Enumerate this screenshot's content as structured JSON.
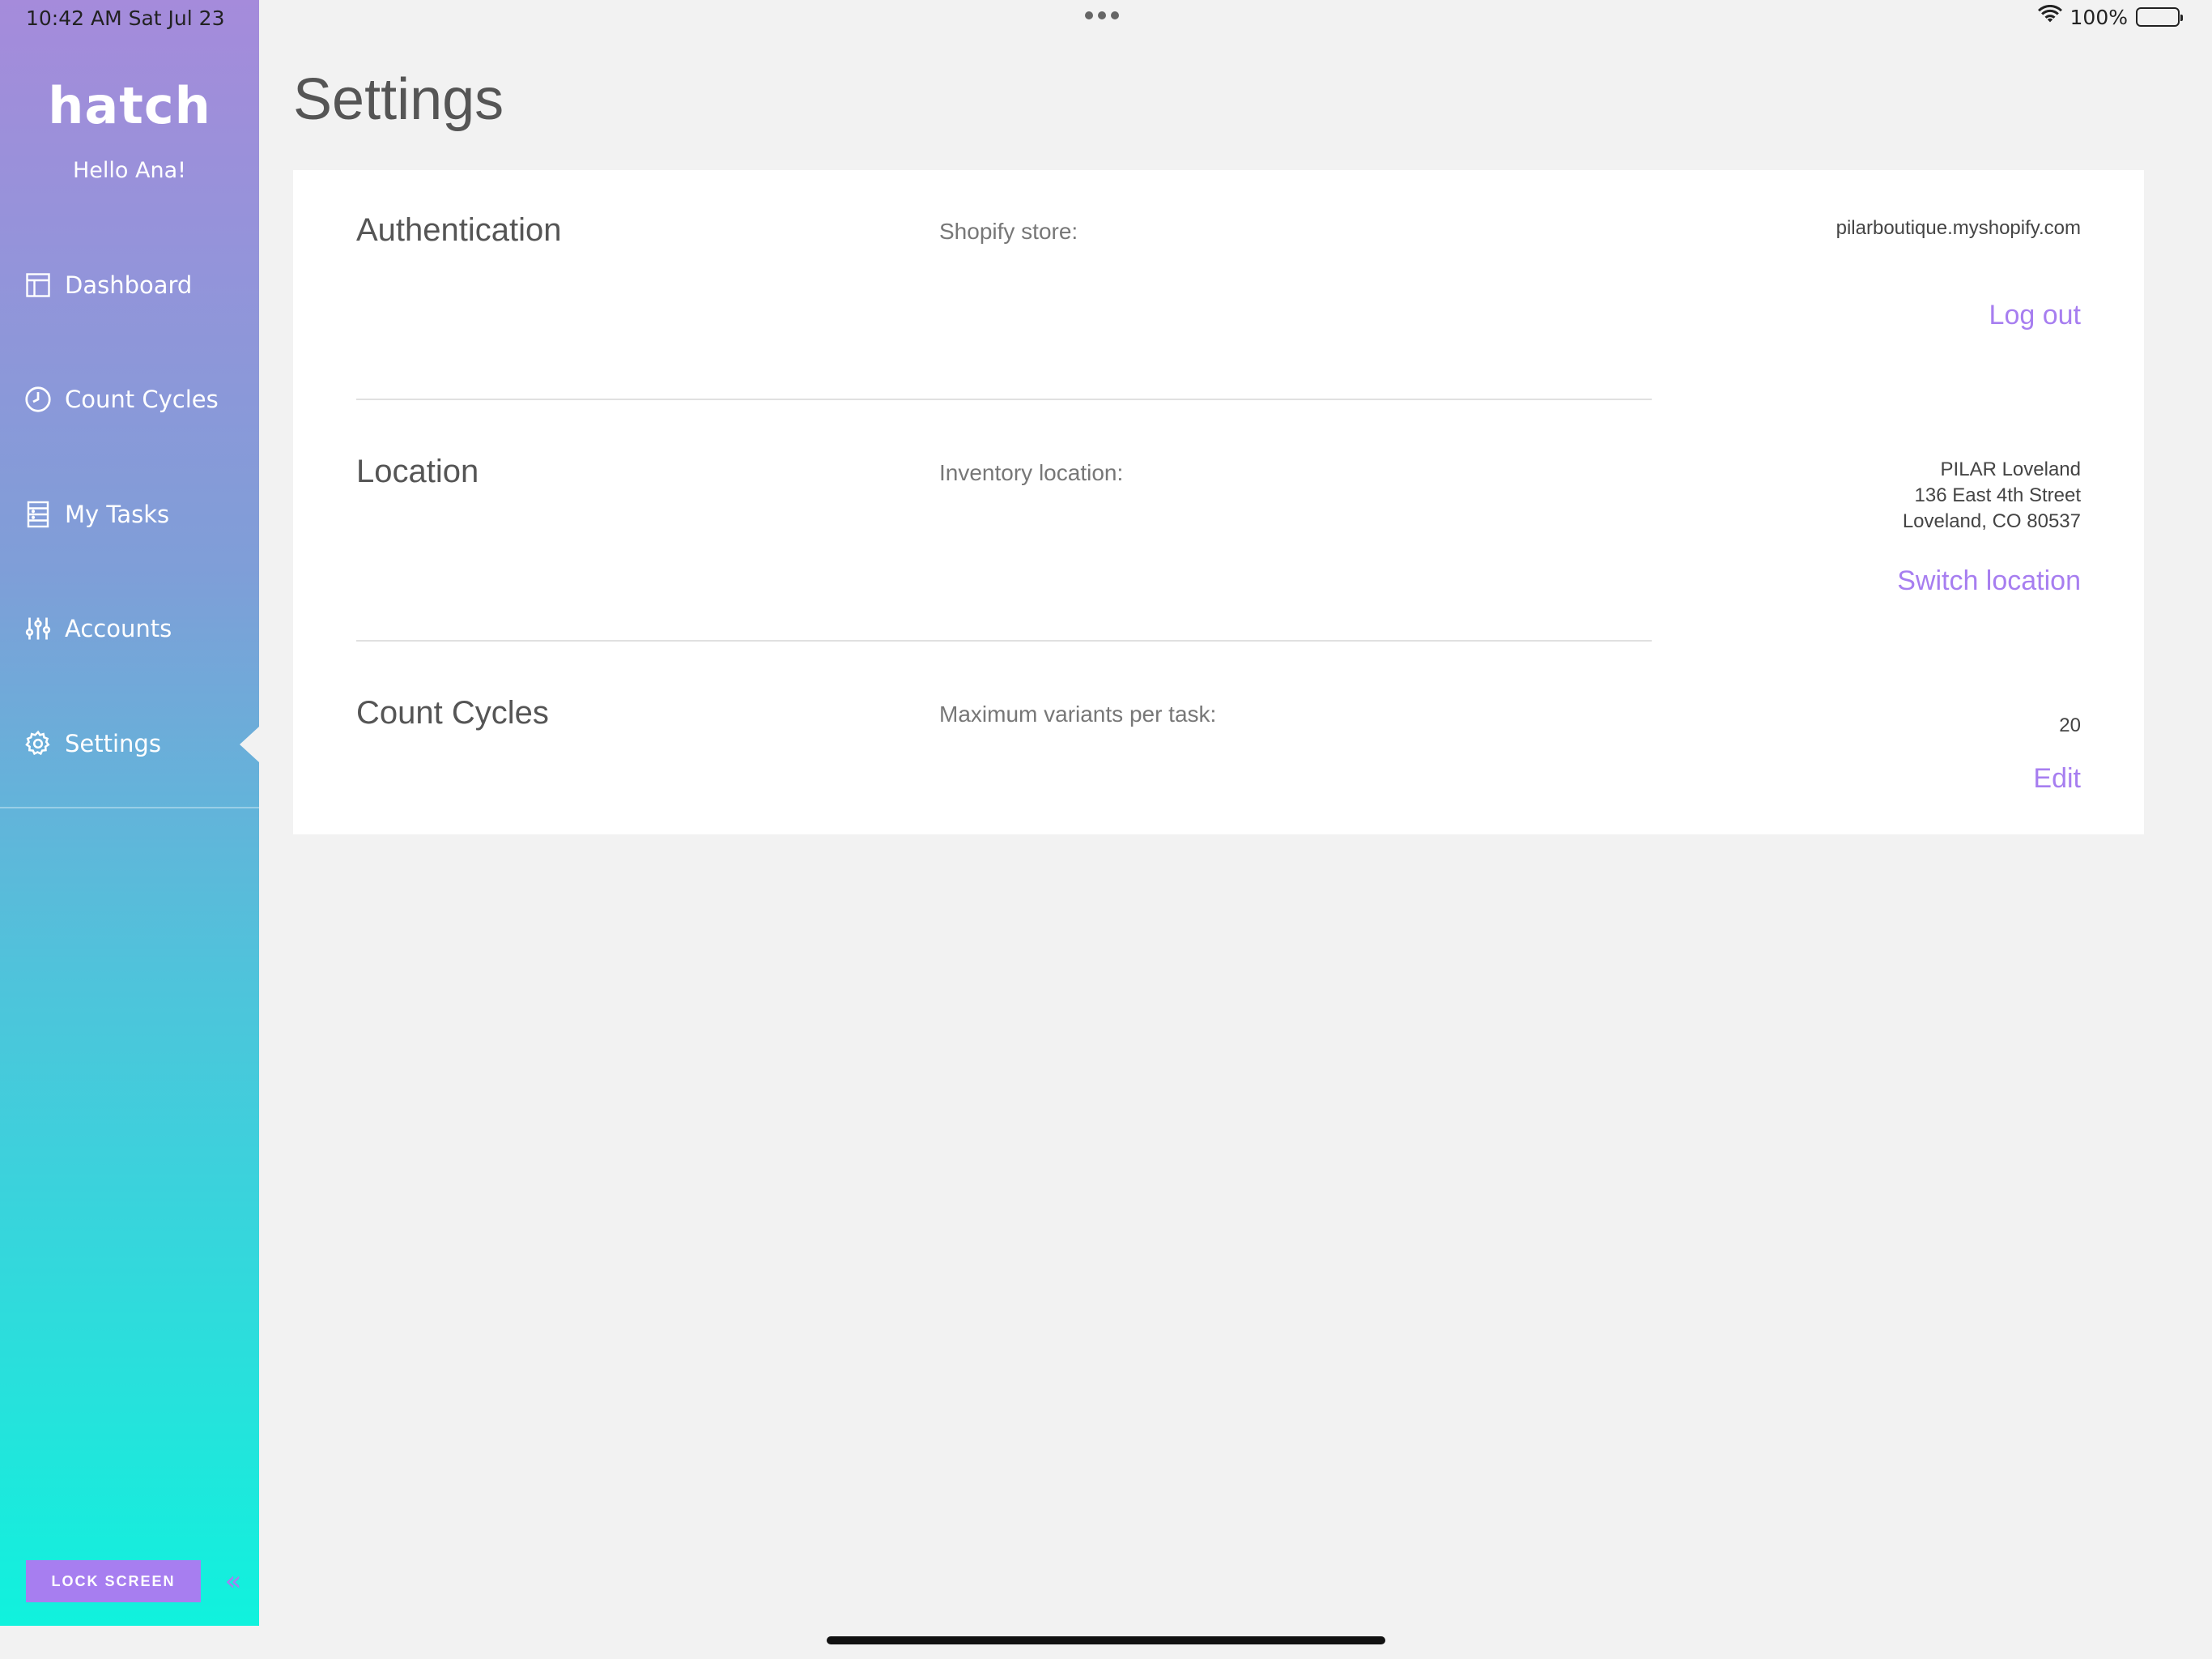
{
  "status_bar": {
    "time": "10:42 AM   Sat Jul 23",
    "battery": "100%",
    "icons": [
      "wifi-icon",
      "battery-icon"
    ]
  },
  "sidebar": {
    "logo": "hatch",
    "greeting": "Hello Ana!",
    "items": [
      {
        "label": "Dashboard",
        "icon": "dashboard-icon"
      },
      {
        "label": "Count Cycles",
        "icon": "clock-icon"
      },
      {
        "label": "My Tasks",
        "icon": "tasks-icon"
      },
      {
        "label": "Accounts",
        "icon": "sliders-icon"
      },
      {
        "label": "Settings",
        "icon": "gear-icon",
        "active": true
      }
    ],
    "lock_label": "LOCK SCREEN",
    "collapse_label": "«"
  },
  "page": {
    "title": "Settings"
  },
  "sections": [
    {
      "title": "Authentication",
      "label": "Shopify store:",
      "value_lines": [
        "pilarboutique.myshopify.com"
      ],
      "action": "Log out"
    },
    {
      "title": "Location",
      "label": "Inventory location:",
      "value_lines": [
        "PILAR Loveland",
        "136 East 4th Street",
        "Loveland, CO 80537"
      ],
      "action": "Switch location"
    },
    {
      "title": "Count Cycles",
      "label": "Maximum variants per task:",
      "value_lines": [
        "20"
      ],
      "action": "Edit"
    }
  ],
  "colors": {
    "accent": "#a77ef0",
    "background": "#f2f2f2",
    "card": "#ffffff"
  }
}
